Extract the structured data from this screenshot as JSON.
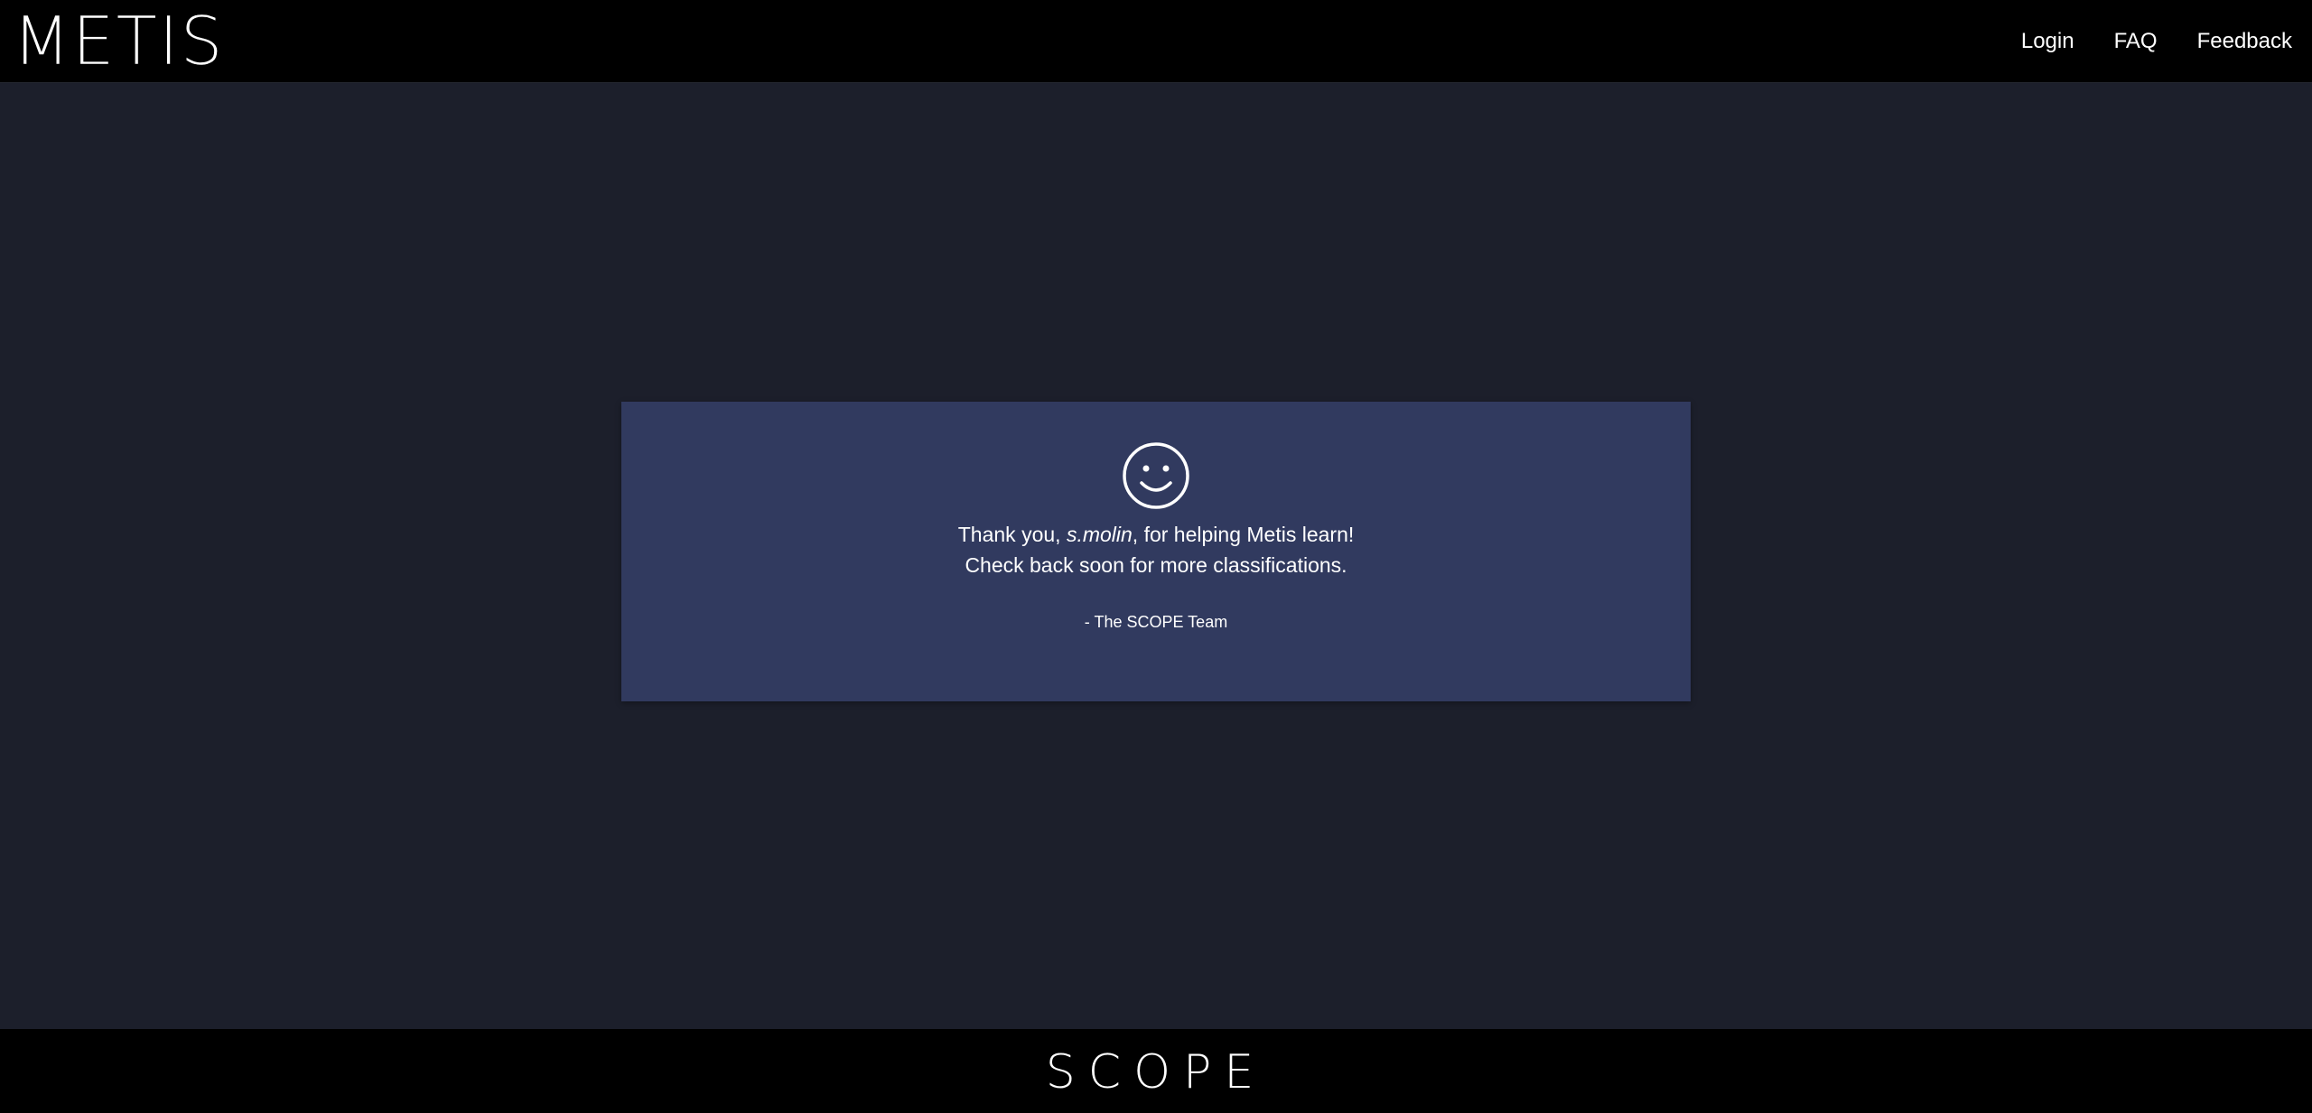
{
  "header": {
    "logo": "METIS",
    "nav": {
      "login": "Login",
      "faq": "FAQ",
      "feedback": "Feedback"
    }
  },
  "card": {
    "icon": "smiley-face-icon",
    "line1_prefix": "Thank you, ",
    "username": "s.molin",
    "line1_suffix": ", for helping Metis learn!",
    "line2": "Check back soon for more classifications.",
    "signature": "- The SCOPE Team"
  },
  "footer": {
    "logo": "SCOPE"
  },
  "colors": {
    "page_background": "#1c1f2b",
    "bar_background": "#000000",
    "card_background": "#313a5f",
    "text": "#ffffff"
  }
}
